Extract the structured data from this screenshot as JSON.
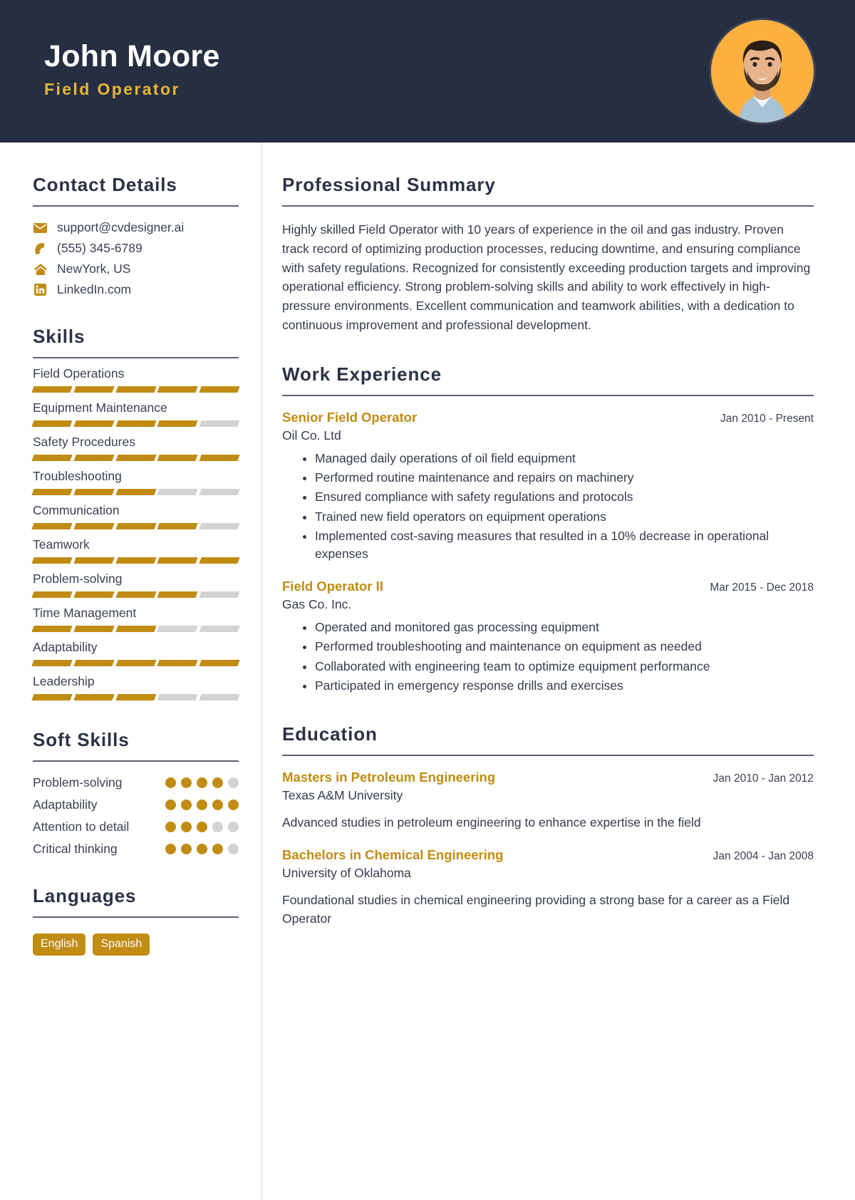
{
  "theme": {
    "header_bg": "#262f41",
    "accent_gold": "#c08c14",
    "role_gold": "#e8b63c",
    "avatar_bg": "#fbb040",
    "muted_gray": "#d2d3d5",
    "text_dark": "#2b3245"
  },
  "header": {
    "name": "John Moore",
    "role": "Field Operator",
    "avatar_icon": "user-photo"
  },
  "sidebar": {
    "contact": {
      "title": "Contact Details",
      "items": [
        {
          "icon": "envelope-icon",
          "value": "support@cvdesigner.ai"
        },
        {
          "icon": "phone-icon",
          "value": "(555) 345-6789"
        },
        {
          "icon": "home-icon",
          "value": "NewYork, US"
        },
        {
          "icon": "linkedin-icon",
          "value": "LinkedIn.com"
        }
      ]
    },
    "skills": {
      "title": "Skills",
      "max": 5,
      "items": [
        {
          "label": "Field Operations",
          "level": 5
        },
        {
          "label": "Equipment Maintenance",
          "level": 4
        },
        {
          "label": "Safety Procedures",
          "level": 5
        },
        {
          "label": "Troubleshooting",
          "level": 3
        },
        {
          "label": "Communication",
          "level": 4
        },
        {
          "label": "Teamwork",
          "level": 5
        },
        {
          "label": "Problem-solving",
          "level": 4
        },
        {
          "label": "Time Management",
          "level": 3
        },
        {
          "label": "Adaptability",
          "level": 5
        },
        {
          "label": "Leadership",
          "level": 3
        }
      ]
    },
    "soft_skills": {
      "title": "Soft Skills",
      "max": 5,
      "items": [
        {
          "label": "Problem-solving",
          "level": 4
        },
        {
          "label": "Adaptability",
          "level": 5
        },
        {
          "label": "Attention to detail",
          "level": 3
        },
        {
          "label": "Critical thinking",
          "level": 4
        }
      ]
    },
    "languages": {
      "title": "Languages",
      "items": [
        "English",
        "Spanish"
      ]
    }
  },
  "main": {
    "summary": {
      "title": "Professional Summary",
      "text": "Highly skilled Field Operator with 10 years of experience in the oil and gas industry. Proven track record of optimizing production processes, reducing downtime, and ensuring compliance with safety regulations. Recognized for consistently exceeding production targets and improving operational efficiency. Strong problem-solving skills and ability to work effectively in high-pressure environments. Excellent communication and teamwork abilities, with a dedication to continuous improvement and professional development."
    },
    "work": {
      "title": "Work Experience",
      "entries": [
        {
          "position": "Senior Field Operator",
          "company": "Oil Co. Ltd",
          "date": "Jan 2010 - Present",
          "bullets": [
            "Managed daily operations of oil field equipment",
            "Performed routine maintenance and repairs on machinery",
            "Ensured compliance with safety regulations and protocols",
            "Trained new field operators on equipment operations",
            "Implemented cost-saving measures that resulted in a 10% decrease in operational expenses"
          ]
        },
        {
          "position": "Field Operator II",
          "company": "Gas Co. Inc.",
          "date": "Mar 2015 - Dec 2018",
          "bullets": [
            "Operated and monitored gas processing equipment",
            "Performed troubleshooting and maintenance on equipment as needed",
            "Collaborated with engineering team to optimize equipment performance",
            "Participated in emergency response drills and exercises"
          ]
        }
      ]
    },
    "education": {
      "title": "Education",
      "entries": [
        {
          "degree": "Masters in Petroleum Engineering",
          "school": "Texas A&M University",
          "date": "Jan 2010 - Jan 2012",
          "description": "Advanced studies in petroleum engineering to enhance expertise in the field"
        },
        {
          "degree": "Bachelors in Chemical Engineering",
          "school": "University of Oklahoma",
          "date": "Jan 2004 - Jan 2008",
          "description": "Foundational studies in chemical engineering providing a strong base for a career as a Field Operator"
        }
      ]
    }
  }
}
